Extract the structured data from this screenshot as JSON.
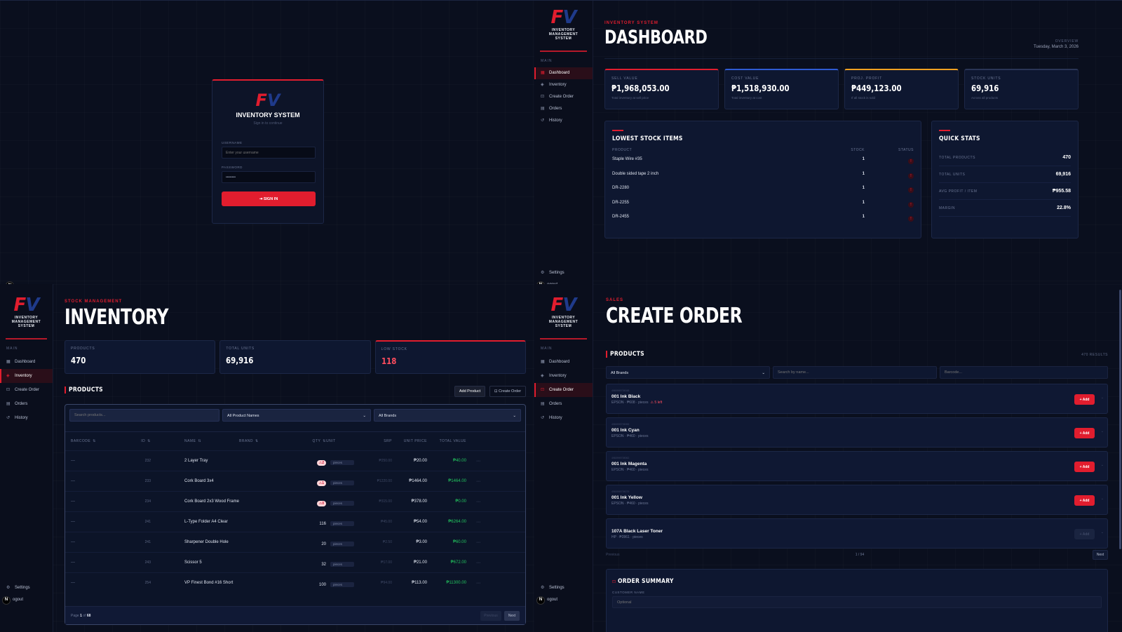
{
  "brand": {
    "f": "F",
    "v": "V",
    "subtitle_lines": [
      "INVENTORY",
      "MANAGEMENT",
      "SYSTEM"
    ],
    "accent": "#e11d2e",
    "secondary": "#1f3a8a"
  },
  "login": {
    "title": "INVENTORY SYSTEM",
    "subtitle": "Sign in to continue",
    "username_label": "USERNAME",
    "username_placeholder": "Enter your username",
    "password_label": "PASSWORD",
    "password_value": "••••••••",
    "signin_label": "SIGN IN",
    "badge": "N"
  },
  "sidebar": {
    "section": "MAIN",
    "items": [
      {
        "label": "Dashboard",
        "icon": "grid-icon"
      },
      {
        "label": "Inventory",
        "icon": "box-icon"
      },
      {
        "label": "Create Order",
        "icon": "cart-icon"
      },
      {
        "label": "Orders",
        "icon": "clipboard-icon"
      },
      {
        "label": "History",
        "icon": "history-icon"
      }
    ],
    "settings_label": "Settings",
    "logout_label": "ogout",
    "badge": "N"
  },
  "dashboard": {
    "eyebrow": "INVENTORY SYSTEM",
    "title": "DASHBOARD",
    "overview_label": "OVERVIEW",
    "date": "Tuesday, March 3, 2026",
    "stats": [
      {
        "label": "SELL VALUE",
        "value": "₱1,968,053.00",
        "sub": "Total inventory at sell price",
        "color": "#e11d2e"
      },
      {
        "label": "COST VALUE",
        "value": "₱1,518,930.00",
        "sub": "Total inventory at cost",
        "color": "#2f5bd3"
      },
      {
        "label": "PROJ. PROFIT",
        "value": "₱449,123.00",
        "sub": "If all stock is sold",
        "color": "#f0a020"
      },
      {
        "label": "STOCK UNITS",
        "value": "69,916",
        "sub": "Across all products",
        "color": "#2a3556"
      }
    ],
    "lowest": {
      "title": "LOWEST STOCK ITEMS",
      "headers": [
        "PRODUCT",
        "STOCK",
        "STATUS"
      ],
      "rows": [
        {
          "product": "Staple Wire #35",
          "stock": "1",
          "status": "!"
        },
        {
          "product": "Double sided tape 2 inch",
          "stock": "1",
          "status": "!"
        },
        {
          "product": "DR-2280",
          "stock": "1",
          "status": "!"
        },
        {
          "product": "DR-2255",
          "stock": "1",
          "status": "!"
        },
        {
          "product": "DR-2455",
          "stock": "1",
          "status": "!"
        }
      ]
    },
    "quick": {
      "title": "QUICK STATS",
      "rows": [
        {
          "label": "TOTAL PRODUCTS",
          "value": "470"
        },
        {
          "label": "TOTAL UNITS",
          "value": "69,916"
        },
        {
          "label": "AVG PROFIT / ITEM",
          "value": "₱955.58"
        },
        {
          "label": "MARGIN",
          "value": "22.8%"
        }
      ]
    }
  },
  "inventory": {
    "eyebrow": "STOCK MANAGEMENT",
    "title": "INVENTORY",
    "stats": [
      {
        "label": "PRODUCTS",
        "value": "470"
      },
      {
        "label": "TOTAL UNITS",
        "value": "69,916"
      },
      {
        "label": "LOW STOCK",
        "value": "118"
      }
    ],
    "section_title": "PRODUCTS",
    "add_product_label": "Add Product",
    "create_order_label": "Create Order",
    "search_placeholder": "Search products...",
    "filter_names": "All Product Names",
    "filter_brands": "All Brands",
    "headers": [
      "BARCODE",
      "ID",
      "NAME",
      "BRAND",
      "QTY",
      "UNIT",
      "SRP",
      "UNIT PRICE",
      "TOTAL VALUE"
    ],
    "rows": [
      {
        "barcode": "—",
        "id": "232",
        "name": "2 Layer Tray",
        "brand": "",
        "qty": "⚠2",
        "warn": true,
        "unit": "pieces",
        "srp": "₱250.00",
        "unit_price": "₱20.00",
        "total": "₱40.00"
      },
      {
        "barcode": "—",
        "id": "233",
        "name": "Cork Board 3x4",
        "brand": "",
        "qty": "⚠1",
        "warn": true,
        "unit": "pieces",
        "srp": "₱1220.00",
        "unit_price": "₱1464.00",
        "total": "₱1464.00"
      },
      {
        "barcode": "—",
        "id": "234",
        "name": "Cork Board 2x3 Wood Frame",
        "brand": "",
        "qty": "⚠0",
        "warn": true,
        "unit": "pieces",
        "srp": "₱315.00",
        "unit_price": "₱378.00",
        "total": "₱0.00"
      },
      {
        "barcode": "—",
        "id": "241",
        "name": "L-Type Folder A4 Clear",
        "brand": "",
        "qty": "116",
        "warn": false,
        "unit": "pieces",
        "srp": "₱45.00",
        "unit_price": "₱54.00",
        "total": "₱6264.00"
      },
      {
        "barcode": "—",
        "id": "241",
        "name": "Sharpener Double Hole",
        "brand": "",
        "qty": "20",
        "warn": false,
        "unit": "pieces",
        "srp": "₱2.50",
        "unit_price": "₱3.00",
        "total": "₱60.00"
      },
      {
        "barcode": "—",
        "id": "243",
        "name": "Scissor 5",
        "brand": "",
        "qty": "32",
        "warn": false,
        "unit": "pieces",
        "srp": "₱17.00",
        "unit_price": "₱21.00",
        "total": "₱672.00"
      },
      {
        "barcode": "—",
        "id": "254",
        "name": "VP Finest Bond #16 Short",
        "brand": "",
        "qty": "100",
        "warn": false,
        "unit": "pieces",
        "srp": "₱94.00",
        "unit_price": "₱113.00",
        "total": "₱11300.00"
      }
    ],
    "page_label": "Page",
    "page_current": "1",
    "page_of": "of",
    "page_total": "68",
    "prev_label": "Previous",
    "next_label": "Next"
  },
  "order": {
    "eyebrow": "SALES",
    "title": "CREATE ORDER",
    "section_title": "PRODUCTS",
    "results": "470 RESULTS",
    "filter_brands": "All Brands",
    "search_placeholder": "Search by name...",
    "barcode_placeholder": "Barcode...",
    "products": [
      {
        "code": "4960999705048",
        "name": "001 Ink Black",
        "meta": "EPSON · ₱608 · pieces",
        "warn": "⚠ 5 left",
        "add": "+ Add",
        "enabled": true
      },
      {
        "code": "4960999705055",
        "name": "001 Ink Cyan",
        "meta": "EPSON · ₱460 · pieces",
        "warn": "",
        "add": "+ Add",
        "enabled": true
      },
      {
        "code": "4960999705062",
        "name": "001 Ink Magenta",
        "meta": "EPSON · ₱460 · pieces",
        "warn": "",
        "add": "+ Add",
        "enabled": true
      },
      {
        "code": "4960999705079",
        "name": "001 Ink Yellow",
        "meta": "EPSON · ₱460 · pieces",
        "warn": "",
        "add": "+ Add",
        "enabled": true
      },
      {
        "code": "",
        "name": "107A Black Laser Toner",
        "meta": "HP · ₱2861 · pieces",
        "warn": "",
        "add": "+ Add",
        "enabled": false
      }
    ],
    "prev_label": "Previous",
    "page_indicator": "1 / 94",
    "next_label": "Next",
    "summary_title": "ORDER SUMMARY",
    "customer_label": "CUSTOMER NAME",
    "customer_placeholder": "Optional"
  }
}
